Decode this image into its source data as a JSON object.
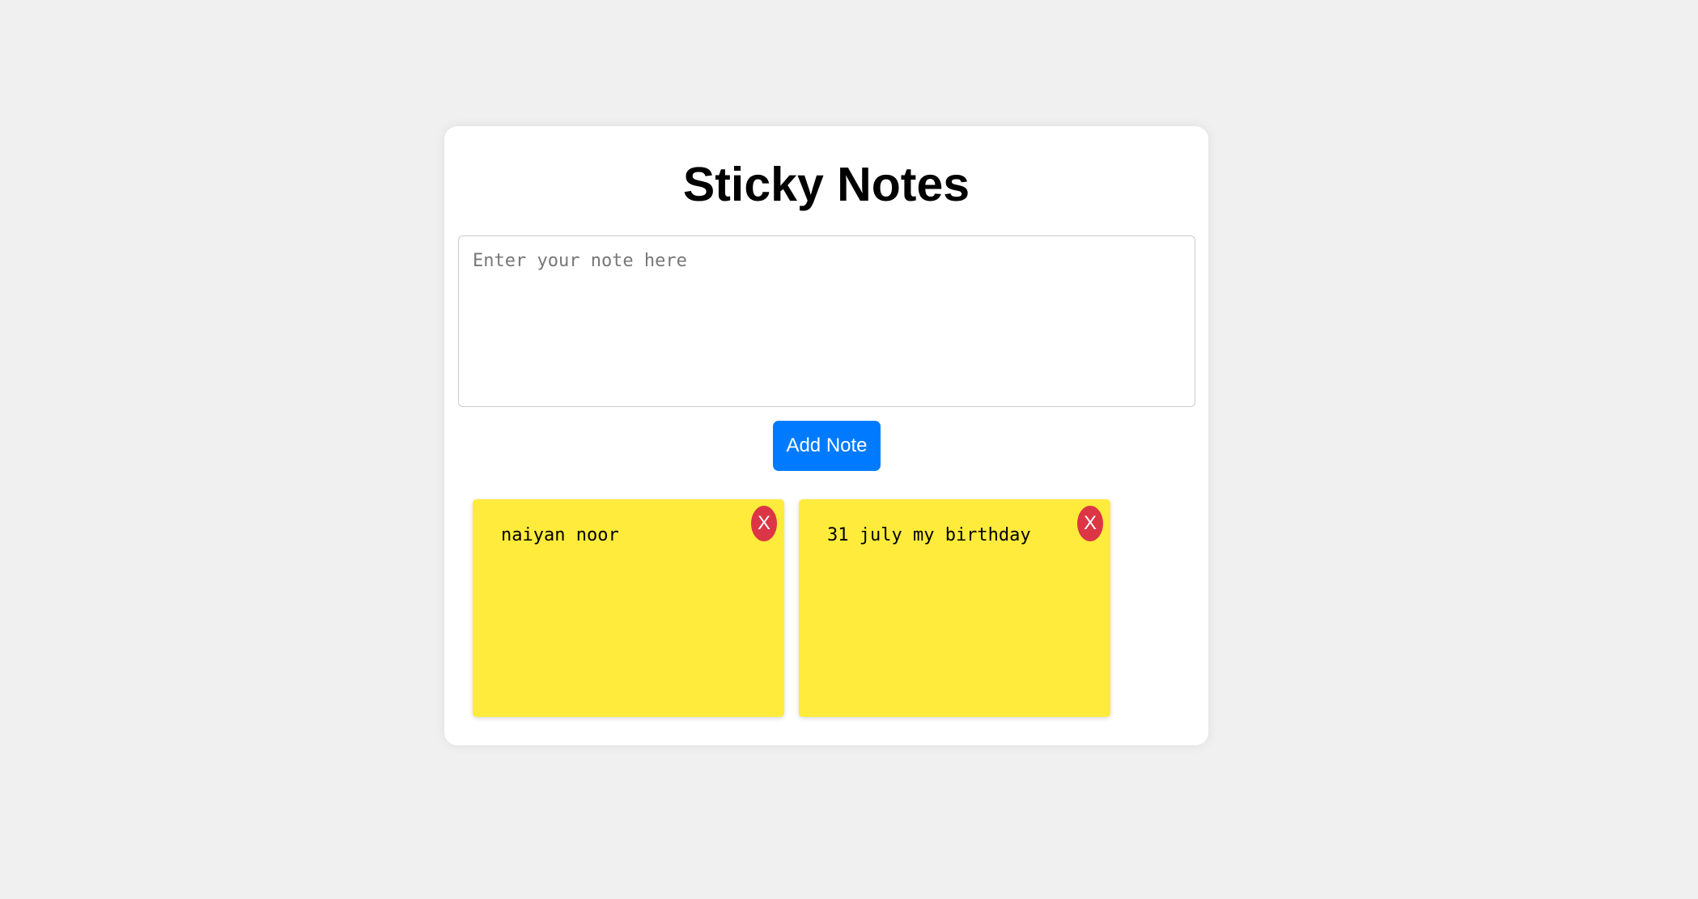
{
  "app": {
    "title": "Sticky Notes"
  },
  "input": {
    "placeholder": "Enter your note here",
    "value": ""
  },
  "actions": {
    "add_label": "Add Note"
  },
  "notes": [
    {
      "text": "naiyan noor",
      "delete_label": "X"
    },
    {
      "text": "31 july my birthday",
      "delete_label": "X"
    }
  ],
  "colors": {
    "page_background": "#f0f0f0",
    "card_background": "#ffffff",
    "accent_button": "#007bff",
    "note_background": "#ffeb3b",
    "delete_button": "#dc3545"
  }
}
